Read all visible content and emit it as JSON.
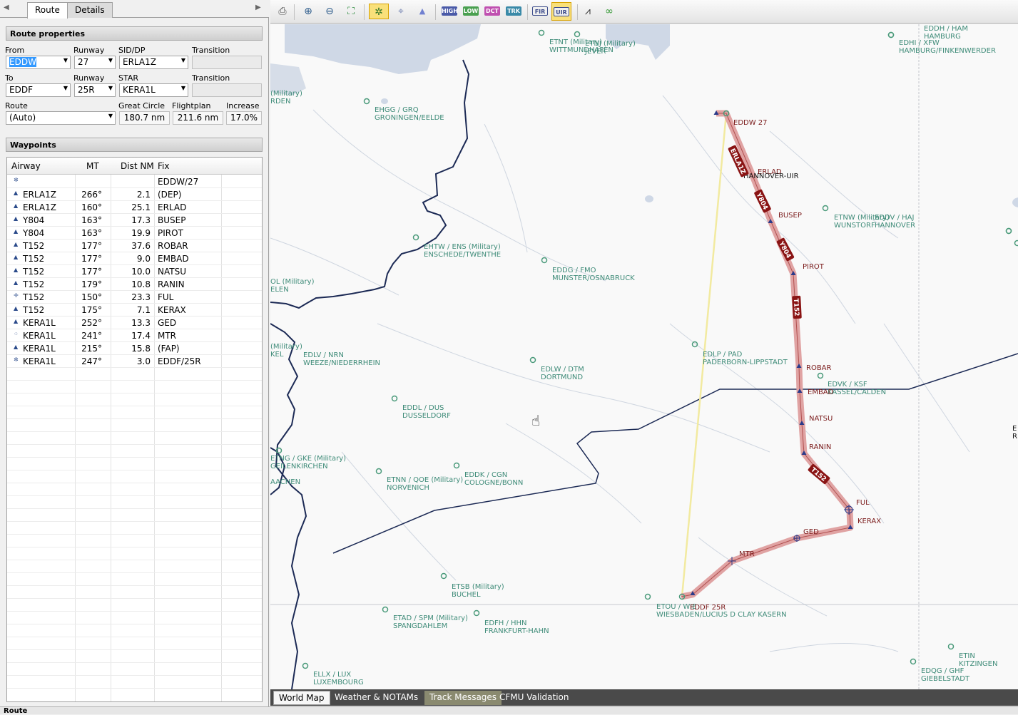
{
  "tabs": {
    "route": "Route",
    "details": "Details"
  },
  "route_properties": {
    "title": "Route properties",
    "from_label": "From",
    "from": "EDDW",
    "runway_label": "Runway",
    "dep_runway": "27",
    "sid_label": "SID/DP",
    "sid": "ERLA1Z",
    "transition_label": "Transition",
    "to_label": "To",
    "to": "EDDF",
    "runway2_label": "Runway",
    "arr_runway": "25R",
    "star_label": "STAR",
    "star": "KERA1L",
    "transition2_label": "Transition",
    "route_label": "Route",
    "route": "(Auto)",
    "gc_label": "Great Circle",
    "gc": "180.7 nm",
    "fp_label": "Flightplan",
    "fp": "211.6 nm",
    "inc_label": "Increase",
    "inc": "17.0%"
  },
  "waypoints": {
    "title": "Waypoints",
    "headers": {
      "airway": "Airway",
      "mt": "MT",
      "dist": "Dist NM",
      "fix": "Fix"
    },
    "rows": [
      {
        "icon": "airport-icon",
        "airway": "",
        "mt": "",
        "dist": "",
        "fix": "EDDW/27"
      },
      {
        "icon": "triangle-icon",
        "airway": "ERLA1Z",
        "mt": "266°",
        "dist": "2.1",
        "fix": "(DEP)"
      },
      {
        "icon": "triangle-icon",
        "airway": "ERLA1Z",
        "mt": "160°",
        "dist": "25.1",
        "fix": "ERLAD"
      },
      {
        "icon": "triangle-icon",
        "airway": "Y804",
        "mt": "163°",
        "dist": "17.3",
        "fix": "BUSEP"
      },
      {
        "icon": "triangle-icon",
        "airway": "Y804",
        "mt": "163°",
        "dist": "19.9",
        "fix": "PIROT"
      },
      {
        "icon": "triangle-icon",
        "airway": "T152",
        "mt": "177°",
        "dist": "37.6",
        "fix": "ROBAR"
      },
      {
        "icon": "triangle-icon",
        "airway": "T152",
        "mt": "177°",
        "dist": "9.0",
        "fix": "EMBAD"
      },
      {
        "icon": "triangle-icon",
        "airway": "T152",
        "mt": "177°",
        "dist": "10.0",
        "fix": "NATSU"
      },
      {
        "icon": "triangle-icon",
        "airway": "T152",
        "mt": "179°",
        "dist": "10.8",
        "fix": "RANIN"
      },
      {
        "icon": "vor-icon",
        "airway": "T152",
        "mt": "150°",
        "dist": "23.3",
        "fix": "FUL"
      },
      {
        "icon": "triangle-icon",
        "airway": "T152",
        "mt": "175°",
        "dist": "7.1",
        "fix": "KERAX"
      },
      {
        "icon": "triangle-icon",
        "airway": "KERA1L",
        "mt": "252°",
        "dist": "13.3",
        "fix": "GED"
      },
      {
        "icon": "ndb-icon",
        "airway": "KERA1L",
        "mt": "241°",
        "dist": "17.4",
        "fix": "MTR"
      },
      {
        "icon": "triangle-icon",
        "airway": "KERA1L",
        "mt": "215°",
        "dist": "15.8",
        "fix": "(FAP)"
      },
      {
        "icon": "airport-icon",
        "airway": "KERA1L",
        "mt": "247°",
        "dist": "3.0",
        "fix": "EDDF/25R"
      }
    ]
  },
  "toolbar": {
    "high": "HIGH",
    "low": "LOW",
    "dct": "DCT",
    "trk": "TRK",
    "fir": "FIR",
    "uir": "UIR"
  },
  "map": {
    "airports": [
      {
        "code": "EDDH / HAM",
        "name": "HAMBURG"
      },
      {
        "code": "EDHI / XFW",
        "name": "HAMBURG/FINKENWERDER"
      },
      {
        "code": "ETNT (Military)",
        "name": "WITTMUNDHAFEN"
      },
      {
        "code": "ETNJ (Military)",
        "name": "JEVER"
      },
      {
        "code": "(Military)",
        "name": "RDEN"
      },
      {
        "code": "EHGG / GRQ",
        "name": "GRONINGEN/EELDE"
      },
      {
        "code": "EHTW / ENS (Military)",
        "name": "ENSCHEDE/TWENTHE"
      },
      {
        "code": "EDDG / FMO",
        "name": "MUNSTER/OSNABRUCK"
      },
      {
        "code": "OL (Military)",
        "name": "ELEN"
      },
      {
        "code": "ETNW (Military)",
        "name": "WUNSTORF"
      },
      {
        "code": "EDDV / HAJ",
        "name": "HANNOVER"
      },
      {
        "code": "EDLP / PAD",
        "name": "PADERBORN-LIPPSTADT"
      },
      {
        "code": "(Military)",
        "name": "KEL"
      },
      {
        "code": "EDLV / NRN",
        "name": "WEEZE/NIEDERRHEIN"
      },
      {
        "code": "EDLW / DTM",
        "name": "DORTMUND"
      },
      {
        "code": "EDVK / KSF",
        "name": "KASSEL/CALDEN"
      },
      {
        "code": "EDDL / DUS",
        "name": "DUSSELDORF"
      },
      {
        "code": "ETNG / GKE (Military)",
        "name": "GEILENKIRCHEN"
      },
      {
        "code": "",
        "name": "AACHEN"
      },
      {
        "code": "ETNN / QOE (Military)",
        "name": "NORVENICH"
      },
      {
        "code": "EDDK / CGN",
        "name": "COLOGNE/BONN"
      },
      {
        "code": "ETSB (Military)",
        "name": "BUCHEL"
      },
      {
        "code": "ETAD / SPM (Military)",
        "name": "SPANGDAHLEM"
      },
      {
        "code": "EDFH / HHN",
        "name": "FRANKFURT-HAHN"
      },
      {
        "code": "ETOU / WIE",
        "name": "WIESBADEN/LUCIUS D CLAY KASERN"
      },
      {
        "code": "ELLX / LUX",
        "name": "LUXEMBOURG"
      },
      {
        "code": "ETIN",
        "name": "KITZINGEN"
      },
      {
        "code": "EDQG / GHF",
        "name": "GIEBELSTADT"
      }
    ],
    "route_labels": {
      "start": "EDDW 27",
      "end": "EDDF 25R"
    },
    "airway_labels": [
      "ERLA1Z",
      "Y804",
      "Y804",
      "T152",
      "T152"
    ],
    "fir_label": "HANNOVER-UIR",
    "waypoint_labels": [
      "ERLAD",
      "BUSEP",
      "PIROT",
      "ROBAR",
      "EMBAD",
      "NATSU",
      "RANIN",
      "FUL",
      "KERAX",
      "GED",
      "MTR"
    ],
    "edge_labels": {
      "e": "E",
      "r": "R"
    }
  },
  "bottom_tabs": [
    "World Map",
    "Weather & NOTAMs",
    "Track Messages",
    "CFMU Validation"
  ],
  "status": "Route"
}
